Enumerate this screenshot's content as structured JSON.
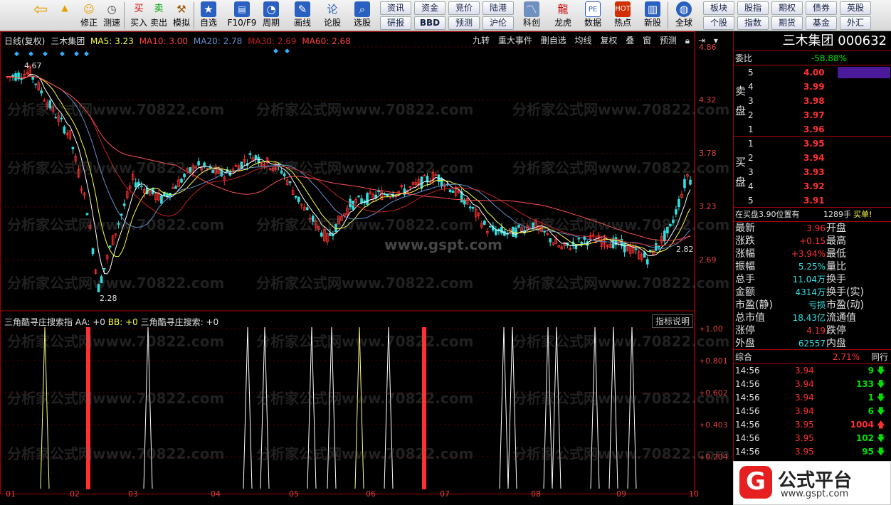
{
  "toolbar": {
    "buttons": [
      "修正",
      "测速",
      "买入",
      "卖出",
      "模拟",
      "自选",
      "F10/F9",
      "周期",
      "画线",
      "论股",
      "选股",
      "科创",
      "龙虎",
      "数据",
      "热点",
      "新股",
      "全球"
    ],
    "small_row1": [
      "资讯",
      "资金",
      "竞价",
      "陆港",
      "板块",
      "股指",
      "期权",
      "债券",
      "英股"
    ],
    "small_row2": [
      "研报",
      "BBD",
      "预测",
      "沪伦",
      "个股",
      "指数",
      "期货",
      "基金",
      "外汇"
    ]
  },
  "chart": {
    "header": {
      "period": "日线(复权)",
      "stock_name": "三木集团",
      "ma5": "MA5: 3.23",
      "ma10": "MA10: 3.00",
      "ma20": "MA20: 2.78",
      "ma30": "MA30: 2.69",
      "ma60": "MA60: 2.68"
    },
    "tools": [
      "九转",
      "重大事件",
      "删自选",
      "均线",
      "复权",
      "叠",
      "窗",
      "预测"
    ],
    "price_axis": [
      "4.86",
      "4.32",
      "3.78",
      "3.23",
      "2.69"
    ],
    "high_label": "4.67",
    "low_label": "2.28",
    "recent_label": "2.82",
    "indicator_header": {
      "name": "三角酷寻庄搜索指",
      "aa": "AA: +0",
      "bb": "BB: +0",
      "search": "三角酷寻庄搜索: +0"
    },
    "indicator_help": "指标说明",
    "indicator_axis": [
      "+1.00",
      "+0.801",
      "+0.602",
      "+0.403",
      "+0.204"
    ],
    "months": [
      "01",
      "02",
      "03",
      "04",
      "05",
      "06",
      "07",
      "08",
      "09",
      "10"
    ],
    "watermark": "分析家公式网www.70822.com",
    "watermark2": "www.gspt.com"
  },
  "quote": {
    "title": "三木集团 000632",
    "weibi_label": "委比",
    "weibi_value": "-58.88%",
    "sell_label": "卖盘",
    "buy_label": "买盘",
    "sells": [
      {
        "level": "5",
        "price": "4.00"
      },
      {
        "level": "4",
        "price": "3.99"
      },
      {
        "level": "3",
        "price": "3.98"
      },
      {
        "level": "2",
        "price": "3.97"
      },
      {
        "level": "1",
        "price": "3.96"
      }
    ],
    "buys": [
      {
        "level": "1",
        "price": "3.95"
      },
      {
        "level": "2",
        "price": "3.94"
      },
      {
        "level": "3",
        "price": "3.93"
      },
      {
        "level": "4",
        "price": "3.92"
      },
      {
        "level": "5",
        "price": "3.91"
      }
    ],
    "order_note": "在买盘3.90位置有",
    "order_qty": "1289手",
    "order_action": "买单!",
    "stats": [
      {
        "k1": "最新",
        "v1": "3.96",
        "k2": "开盘"
      },
      {
        "k1": "涨跌",
        "v1": "+0.15",
        "k2": "最高"
      },
      {
        "k1": "涨幅",
        "v1": "+3.94%",
        "k2": "最低"
      },
      {
        "k1": "振幅",
        "v1": "5.25%",
        "k2": "量比"
      },
      {
        "k1": "总手",
        "v1": "11.04万",
        "k2": "换手"
      },
      {
        "k1": "金额",
        "v1": "4314万",
        "k2": "换手(实)"
      },
      {
        "k1": "市盈(静)",
        "v1": "亏损",
        "k2": "市盈(动)"
      },
      {
        "k1": "总市值",
        "v1": "18.43亿",
        "k2": "流通值"
      },
      {
        "k1": "涨停",
        "v1": "4.19",
        "k2": "跌停"
      },
      {
        "k1": "外盘",
        "v1": "62557",
        "k2": "内盘"
      }
    ],
    "composite_label": "综合",
    "composite_value": "2.71%",
    "composite_right": "同行",
    "ticks": [
      {
        "time": "14:56",
        "price": "3.94",
        "vol": "9",
        "dir": "down"
      },
      {
        "time": "14:56",
        "price": "3.94",
        "vol": "133",
        "dir": "down"
      },
      {
        "time": "14:56",
        "price": "3.94",
        "vol": "1",
        "dir": "down"
      },
      {
        "time": "14:56",
        "price": "3.94",
        "vol": "6",
        "dir": "down"
      },
      {
        "time": "14:56",
        "price": "3.95",
        "vol": "1004",
        "dir": "up"
      },
      {
        "time": "14:56",
        "price": "3.95",
        "vol": "102",
        "dir": "down"
      },
      {
        "time": "14:56",
        "price": "3.95",
        "vol": "95",
        "dir": "down"
      }
    ],
    "logo_text": "公式平台",
    "logo_url": "www.gspt.com"
  }
}
